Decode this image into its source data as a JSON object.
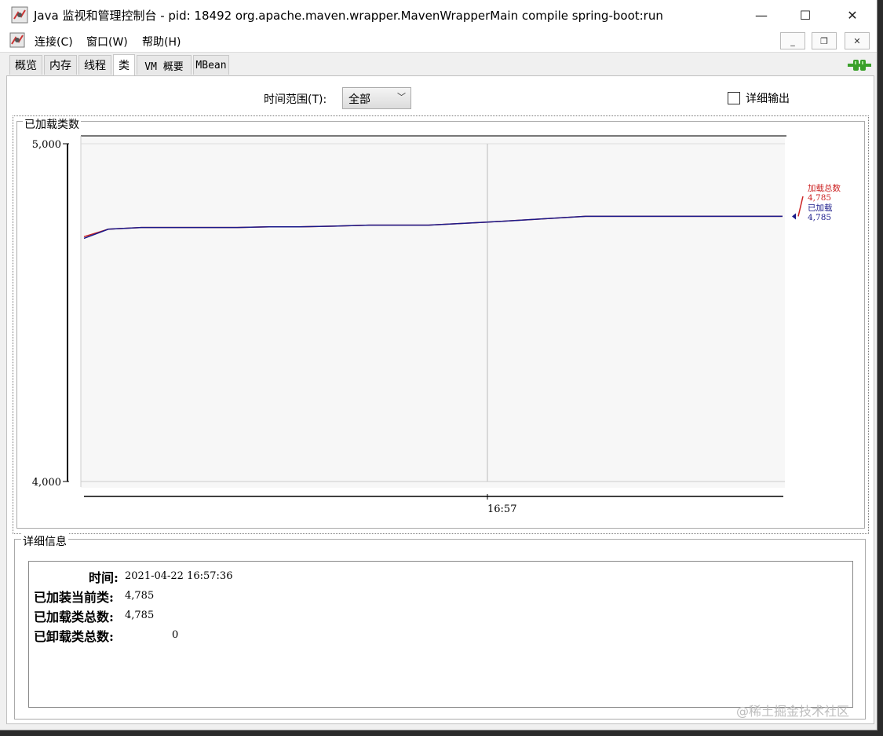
{
  "window": {
    "title": "Java 监视和管理控制台 - pid: 18492 org.apache.maven.wrapper.MavenWrapperMain compile spring-boot:run",
    "minimize_glyph": "—",
    "maximize_glyph": "☐",
    "close_glyph": "✕"
  },
  "menu": {
    "items": [
      {
        "label": "连接(C)"
      },
      {
        "label": "窗口(W)"
      },
      {
        "label": "帮助(H)"
      }
    ]
  },
  "tabs": [
    {
      "label": "概览",
      "active": false
    },
    {
      "label": "内存",
      "active": false
    },
    {
      "label": "线程",
      "active": false
    },
    {
      "label": "类",
      "active": true
    },
    {
      "label": "VM 概要",
      "active": false
    },
    {
      "label": "MBean",
      "active": false
    }
  ],
  "controls": {
    "time_range_label": "时间范围(T):",
    "time_range_value": "全部",
    "verbose_label": "详细输出",
    "verbose_checked": false
  },
  "chart_panel_title": "已加载类数",
  "chart_data": {
    "type": "line",
    "ylim": [
      4000,
      5000
    ],
    "y_tick_labels": [
      "5,000",
      "4,000"
    ],
    "x_tick_labels": [
      "16:57"
    ],
    "grid": true,
    "legend_placement": "right",
    "series": [
      {
        "name": "加载总数",
        "color": "#cc2222",
        "value_label": "4,785",
        "values": [
          4725,
          4747,
          4752,
          4752,
          4752,
          4754,
          4754,
          4756,
          4759,
          4759,
          4768,
          4785,
          4785
        ]
      },
      {
        "name": "已加载",
        "color": "#1a1a8a",
        "value_label": "4,785",
        "values": [
          4720,
          4747,
          4752,
          4752,
          4752,
          4754,
          4754,
          4756,
          4759,
          4759,
          4768,
          4785,
          4785
        ]
      }
    ]
  },
  "details": {
    "title": "详细信息",
    "rows": [
      {
        "label": "时间:",
        "value": "2021-04-22 16:57:36"
      },
      {
        "label": "已加装当前类:",
        "value": "4,785"
      },
      {
        "label": "已加载类总数:",
        "value": "4,785"
      },
      {
        "label": "已卸载类总数:",
        "value": "0"
      }
    ]
  },
  "watermark": "@稀土掘金技术社区",
  "colors": {
    "plot_bg": "#f7f7f7",
    "total_series": "#cc2222",
    "loaded_series": "#1a1a8a",
    "connected_icon": "#3aa02a"
  }
}
